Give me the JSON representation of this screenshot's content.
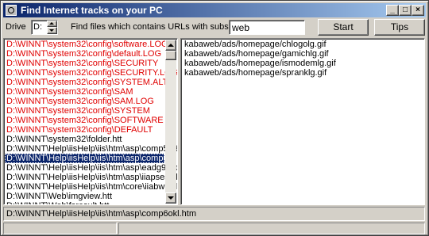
{
  "window": {
    "title": "Find Internet tracks on your PC"
  },
  "toolbar": {
    "drive_label": "Drive",
    "drive_value": "D:",
    "search_label": "Find files which contains URLs with substring",
    "search_value": "web",
    "start_label": "Start",
    "tips_label": "Tips"
  },
  "files": [
    {
      "text": "D:\\WINNT\\system32\\config\\software.LOG",
      "color": "red"
    },
    {
      "text": "D:\\WINNT\\system32\\config\\default.LOG",
      "color": "red"
    },
    {
      "text": "D:\\WINNT\\system32\\config\\SECURITY",
      "color": "red"
    },
    {
      "text": "D:\\WINNT\\system32\\config\\SECURITY.LOG",
      "color": "red"
    },
    {
      "text": "D:\\WINNT\\system32\\config\\SYSTEM.ALT",
      "color": "red"
    },
    {
      "text": "D:\\WINNT\\system32\\config\\SAM",
      "color": "red"
    },
    {
      "text": "D:\\WINNT\\system32\\config\\SAM.LOG",
      "color": "red"
    },
    {
      "text": "D:\\WINNT\\system32\\config\\SYSTEM",
      "color": "red"
    },
    {
      "text": "D:\\WINNT\\system32\\config\\SOFTWARE",
      "color": "red"
    },
    {
      "text": "D:\\WINNT\\system32\\config\\DEFAULT",
      "color": "red"
    },
    {
      "text": "D:\\WINNT\\system32\\folder.htt",
      "color": "black"
    },
    {
      "text": "D:\\WINNT\\Help\\iisHelp\\iis\\htm\\asp\\comp59f8",
      "color": "black"
    },
    {
      "text": "D:\\WINNT\\Help\\iisHelp\\iis\\htm\\asp\\comp6okl.",
      "color": "selected"
    },
    {
      "text": "D:\\WINNT\\Help\\iisHelp\\iis\\htm\\asp\\eadg9mp",
      "color": "black"
    },
    {
      "text": "D:\\WINNT\\Help\\iisHelp\\iis\\htm\\asp\\iiapsess.h",
      "color": "black"
    },
    {
      "text": "D:\\WINNT\\Help\\iisHelp\\iis\\htm\\core\\iiabwbs.h",
      "color": "black"
    },
    {
      "text": "D:\\WINNT\\Web\\imgview.htt",
      "color": "black"
    },
    {
      "text": "D:\\WINNT\\Web\\fsresult.htt",
      "color": "black"
    }
  ],
  "urls": [
    "kabaweb/ads/homepage/chlogolg.gif",
    "kabaweb/ads/homepage/gamichlg.gif",
    "kabaweb/ads/homepage/ismodemlg.gif",
    "kabaweb/ads/homepage/spranklg.gif"
  ],
  "selected_path": "D:\\WINNT\\Help\\iisHelp\\iis\\htm\\asp\\comp6okl.htm",
  "status": {
    "left": "",
    "right": ""
  }
}
